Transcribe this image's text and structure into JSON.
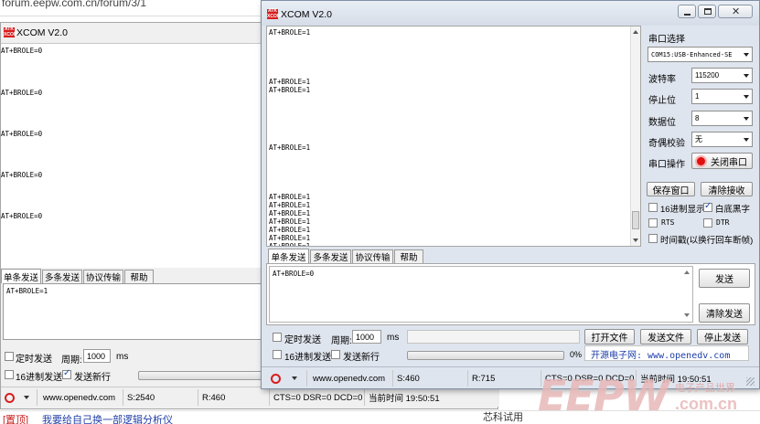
{
  "browser": {
    "url": "forum.eepw.com.cn/forum/3/1"
  },
  "back_window": {
    "title": "XCOM V2.0",
    "rx_lines": [
      "AT+BROLE=0",
      "AT+BROLE=0",
      "AT+BROLE=0",
      "AT+BROLE=0",
      "AT+BROLE=0"
    ],
    "tabs": [
      "单条发送",
      "多条发送",
      "协议传输",
      "帮助"
    ],
    "tx_text": "AT+BROLE=1",
    "timed_send_label": "定时发送",
    "period_label": "周期:",
    "period_value": "1000",
    "period_unit": "ms",
    "hex_send_label": "16进制发送",
    "newline_label": "发送新行",
    "status": {
      "url": "www.openedv.com",
      "sent": "S:2540",
      "received": "R:460",
      "signals": "CTS=0 DSR=0 DCD=0",
      "time": "当前时间 19:50:51"
    }
  },
  "front_window": {
    "title": "XCOM V2.0",
    "rx_lines": [
      "AT+BROLE=1",
      "",
      "",
      "",
      "",
      "",
      "AT+BROLE=1",
      "AT+BROLE=1",
      "",
      "",
      "",
      "",
      "",
      "",
      "AT+BROLE=1",
      "",
      "",
      "",
      "",
      "",
      "AT+BROLE=1",
      "AT+BROLE=1",
      "AT+BROLE=1",
      "AT+BROLE=1",
      "AT+BROLE=1",
      "AT+BROLE=1",
      "AT+BROLE=1"
    ],
    "settings": {
      "port_label": "串口选择",
      "port_value": "COM15:USB-Enhanced-SE",
      "baud_label": "波特率",
      "baud_value": "115200",
      "stop_label": "停止位",
      "stop_value": "1",
      "data_label": "数据位",
      "data_value": "8",
      "parity_label": "奇偶校验",
      "parity_value": "无",
      "op_label": "串口操作",
      "close_port_label": "关闭串口",
      "save_window_label": "保存窗口",
      "clear_rx_label": "清除接收",
      "hex_display_label": "16进制显示",
      "white_bg_label": "白底黑字",
      "rts_label": "RTS",
      "dtr_label": "DTR",
      "timestamp_label": "时间戳(以换行回车断帧)"
    },
    "tabs": [
      "单条发送",
      "多条发送",
      "协议传输",
      "帮助"
    ],
    "tx_text": "AT+BROLE=0",
    "send_label": "发送",
    "clear_send_label": "清除发送",
    "timed_send_label": "定时发送",
    "period_label": "周期:",
    "period_value": "1000",
    "period_unit": "ms",
    "open_file_label": "打开文件",
    "send_file_label": "发送文件",
    "stop_send_label": "停止发送",
    "hex_send_label": "16进制发送",
    "newline_label": "发送新行",
    "progress_text": "0%",
    "ad_text": "开源电子网: www.openedv.com",
    "status": {
      "url": "www.openedv.com",
      "sent": "S:460",
      "received": "R:715",
      "signals": "CTS=0 DSR=0 DCD=0",
      "time": "当前时间 19:50:51"
    }
  },
  "page_bottom": {
    "tag": "[置顶]",
    "link": "我要给自己换一部逻辑分析仪",
    "right_text": "芯科试用",
    "watermark": "EEPW",
    "watermark_cn": "电子产品世界",
    "watermark_domain": ".com.cn"
  },
  "colors": {
    "accent_red": "#d81e1e",
    "ad_blue": "#1f3ea8",
    "watermark": "#e8b8b8"
  }
}
